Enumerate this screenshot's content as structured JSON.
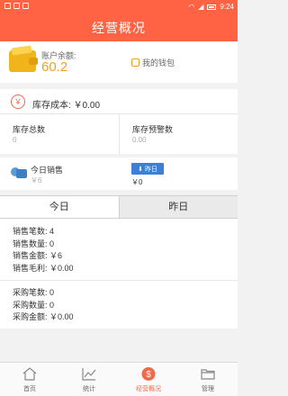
{
  "status_bar": {
    "time": "9:24"
  },
  "app_bar": {
    "title": "经营概况"
  },
  "account": {
    "balance_label": "账户余额:",
    "balance_value": "60.2",
    "wallet_link": "我的钱包"
  },
  "inventory": {
    "cost_label": "库存成本:",
    "cost_value": "￥0.00",
    "total_label": "库存总数",
    "total_value": "0",
    "warning_label": "库存预警数",
    "warning_value": "0.00"
  },
  "sales": {
    "today_label": "今日销售",
    "today_value": "￥6",
    "yesterday_badge": "昨日",
    "yesterday_value": "￥0"
  },
  "tabs": [
    {
      "label": "今日"
    },
    {
      "label": "昨日"
    }
  ],
  "sales_stats": [
    {
      "label": "销售笔数:",
      "value": "4"
    },
    {
      "label": "销售数量:",
      "value": "0"
    },
    {
      "label": "销售金额:",
      "value": "￥6"
    },
    {
      "label": "销售毛利:",
      "value": "￥0.00"
    }
  ],
  "purchase_stats": [
    {
      "label": "采购笔数:",
      "value": "0"
    },
    {
      "label": "采购数量:",
      "value": "0"
    },
    {
      "label": "采购金额:",
      "value": "￥0.00"
    }
  ],
  "nav": [
    {
      "label": "首页",
      "icon": "home-icon"
    },
    {
      "label": "统计",
      "icon": "chart-icon"
    },
    {
      "label": "经营概况",
      "icon": "dollar-icon"
    },
    {
      "label": "管理",
      "icon": "folder-icon"
    }
  ],
  "colors": {
    "accent": "#ff6343",
    "balance": "#f2a01c",
    "badge": "#3b7fd8"
  }
}
